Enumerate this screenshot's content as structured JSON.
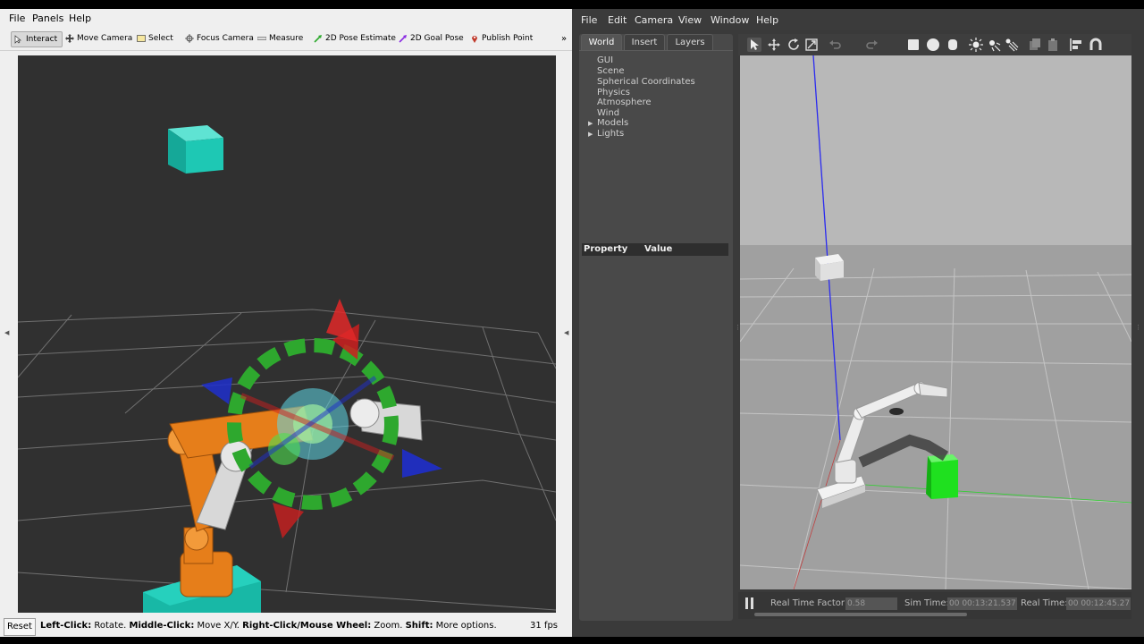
{
  "rviz": {
    "menu": [
      "File",
      "Panels",
      "Help"
    ],
    "tools": [
      {
        "label": "Interact",
        "icon": "cursor-icon",
        "active": true
      },
      {
        "label": "Move Camera",
        "icon": "move-camera-icon"
      },
      {
        "label": "Select",
        "icon": "select-icon"
      },
      {
        "label": "Focus Camera",
        "icon": "focus-camera-icon"
      },
      {
        "label": "Measure",
        "icon": "ruler-icon"
      },
      {
        "label": "2D Pose Estimate",
        "icon": "pose-arrow-icon"
      },
      {
        "label": "2D Goal Pose",
        "icon": "goal-arrow-icon"
      },
      {
        "label": "Publish Point",
        "icon": "location-pin-icon"
      }
    ],
    "overflow": "»",
    "status": {
      "reset_label": "Reset",
      "left_click": "Left-Click:",
      "left_click_desc": " Rotate. ",
      "middle_click": "Middle-Click:",
      "middle_click_desc": " Move X/Y. ",
      "right_click": "Right-Click/Mouse Wheel:",
      "right_click_desc": " Zoom. ",
      "shift": "Shift:",
      "shift_desc": " More options.",
      "fps": "31 fps"
    },
    "colors": {
      "viewport": "#303030",
      "target_cube": "#1ec8b4",
      "arm_orange": "#e67e1a",
      "arm_white": "#d8d8d8",
      "marker_green": "#2ea82e",
      "marker_red": "#cc1f1f",
      "marker_blue": "#1f2fcc"
    }
  },
  "gazebo": {
    "menu": [
      "File",
      "Edit",
      "Camera",
      "View",
      "Window",
      "Help"
    ],
    "tabs": [
      "World",
      "Insert",
      "Layers"
    ],
    "tree": [
      "GUI",
      "Scene",
      "Spherical Coordinates",
      "Physics",
      "Atmosphere",
      "Wind",
      "Models",
      "Lights"
    ],
    "expandable": [
      "Models",
      "Lights"
    ],
    "property_header": {
      "property": "Property",
      "value": "Value"
    },
    "toolbar_icons": [
      "select-arrow-icon",
      "translate-icon",
      "rotate-icon",
      "scale-icon",
      "undo-icon",
      "redo-icon",
      "box-icon",
      "sphere-icon",
      "cylinder-icon",
      "point-light-icon",
      "spot-light-icon",
      "directional-light-icon",
      "copy-icon",
      "paste-icon",
      "align-icon",
      "snap-icon"
    ],
    "bottom": {
      "rtf_label": "Real Time Factor:",
      "rtf_value": "0.58",
      "sim_label": "Sim Time:",
      "sim_value": "00 00:13:21.537",
      "real_label": "Real Time:",
      "real_value": "00 00:12:45.27"
    },
    "colors": {
      "viewport": "#a5a5a5",
      "sky": "#b8b8b8",
      "ground_cube": "#1fe01f",
      "floating_cube": "#e0e0e0"
    }
  }
}
